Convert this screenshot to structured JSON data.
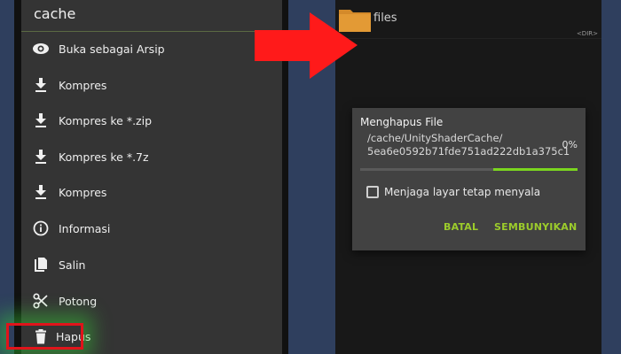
{
  "left_menu": {
    "header": "cache",
    "items": [
      {
        "label": "Buka sebagai Arsip",
        "icon": "eye-icon"
      },
      {
        "label": "Kompres",
        "icon": "download-icon"
      },
      {
        "label": "Kompres ke *.zip",
        "icon": "download-icon"
      },
      {
        "label": "Kompres ke *.7z",
        "icon": "download-icon"
      },
      {
        "label": "Kompres",
        "icon": "download-icon"
      },
      {
        "label": "Informasi",
        "icon": "info-icon"
      },
      {
        "label": "Salin",
        "icon": "copy-icon"
      },
      {
        "label": "Potong",
        "icon": "scissors-icon"
      },
      {
        "label": "Hapus",
        "icon": "trash-icon"
      }
    ]
  },
  "right_panel": {
    "folder_name": "files",
    "folder_tag": "<DIR>"
  },
  "dialog": {
    "title": "Menghapus File",
    "path_line1": "/cache/UnityShaderCache/",
    "path_line2": "5ea6e0592b71fde751ad222db1a375c1",
    "percent": "0%",
    "progress_fraction": 0.0,
    "checkbox_label": "Menjaga layar tetap menyala",
    "checkbox_checked": false,
    "cancel_label": "BATAL",
    "hide_label": "SEMBUNYIKAN"
  },
  "colors": {
    "accent_green": "#9ccc2b",
    "progress_green": "#7bd61f",
    "highlight_red": "#e0141b",
    "background_blue": "#2f3f5e"
  }
}
